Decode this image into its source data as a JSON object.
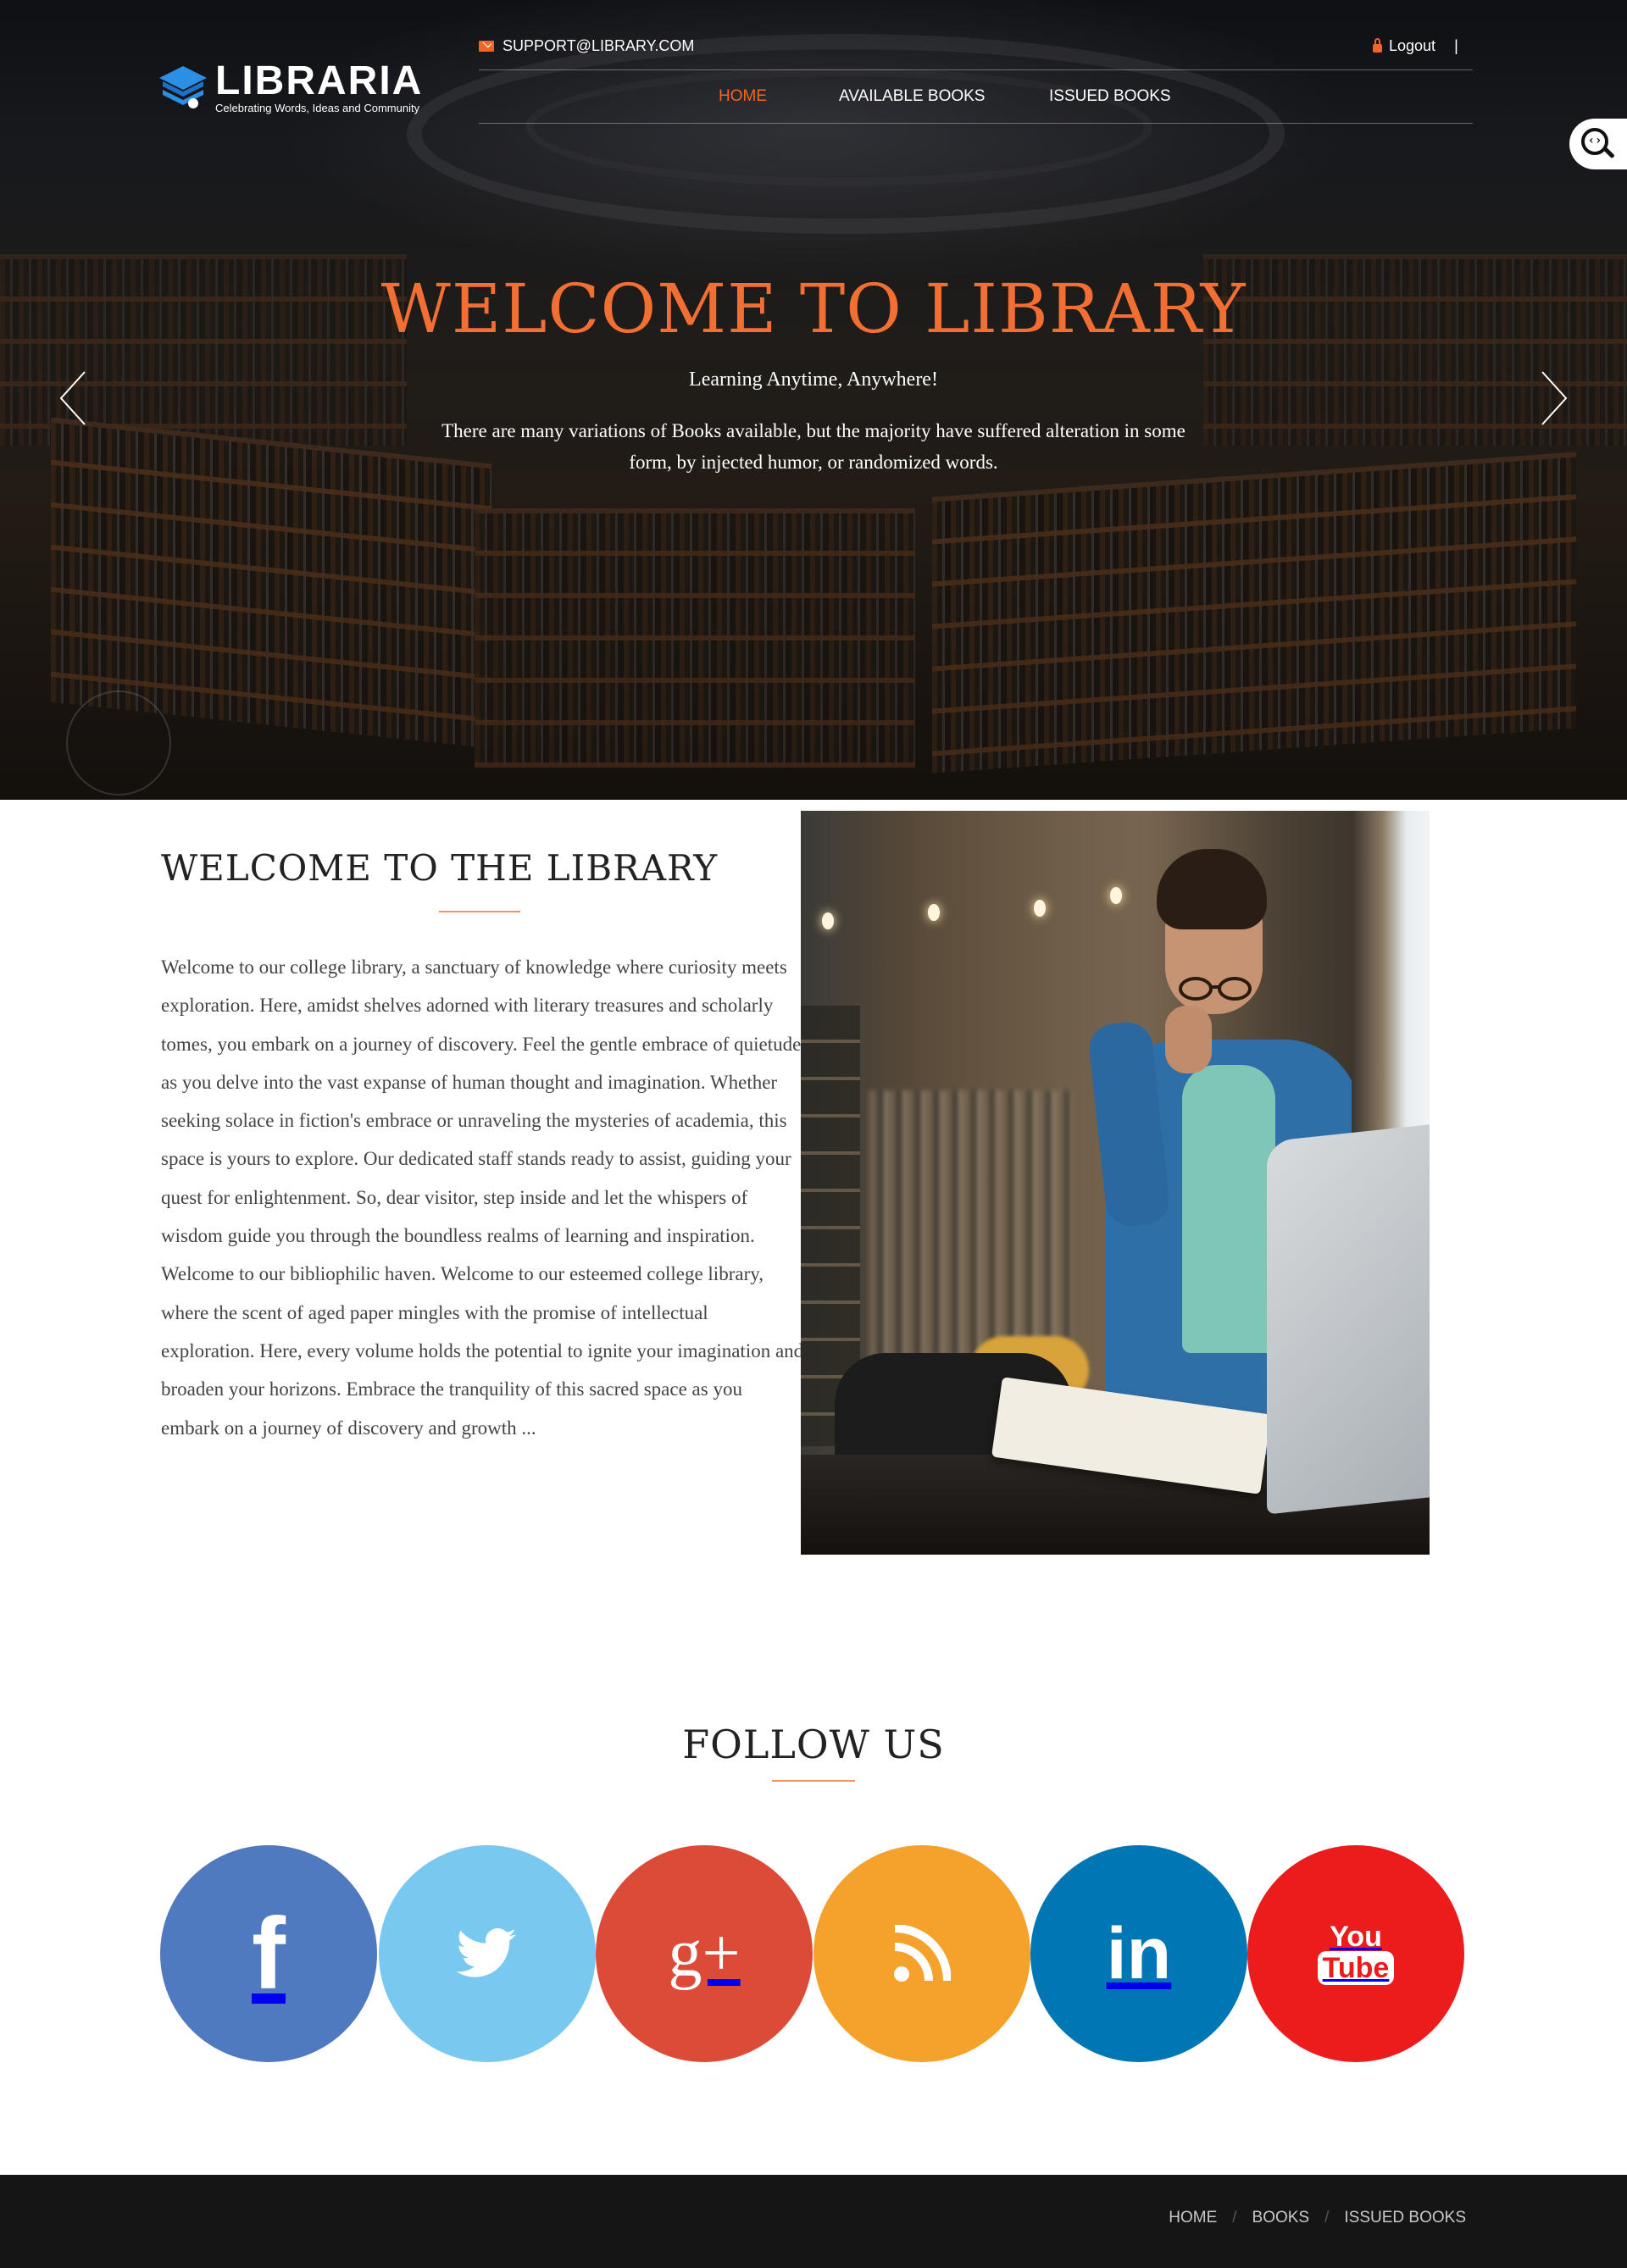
{
  "brand": {
    "name": "LIBRARIA",
    "tagline": "Celebrating Words, Ideas and Community"
  },
  "topbar": {
    "email": "SUPPORT@LIBRARY.COM",
    "logout_label": "Logout",
    "separator": "|"
  },
  "nav": {
    "items": [
      {
        "label": "HOME",
        "active": true
      },
      {
        "label": "AVAILABLE BOOKS",
        "active": false
      },
      {
        "label": "ISSUED BOOKS",
        "active": false
      }
    ]
  },
  "hero": {
    "title": "WELCOME TO LIBRARY",
    "subtitle": "Learning Anytime, Anywhere!",
    "description": "There are many variations of Books available, but the majority have suffered alteration in some form, by injected humor, or randomized words."
  },
  "about": {
    "title": "WELCOME TO THE LIBRARY",
    "text": "Welcome to our college library, a sanctuary of knowledge where curiosity meets exploration. Here, amidst shelves adorned with literary treasures and scholarly tomes, you embark on a journey of discovery. Feel the gentle embrace of quietude as you delve into the vast expanse of human thought and imagination. Whether seeking solace in fiction's embrace or unraveling the mysteries of academia, this space is yours to explore. Our dedicated staff stands ready to assist, guiding your quest for enlightenment. So, dear visitor, step inside and let the whispers of wisdom guide you through the boundless realms of learning and inspiration. Welcome to our bibliophilic haven. Welcome to our esteemed college library, where the scent of aged paper mingles with the promise of intellectual exploration. Here, every volume holds the potential to ignite your imagination and broaden your horizons. Embrace the tranquility of this sacred space as you embark on a journey of discovery and growth ..."
  },
  "follow": {
    "title": "FOLLOW US",
    "networks": [
      {
        "name": "facebook-icon",
        "glyph": "f",
        "color": "#507abf"
      },
      {
        "name": "twitter-icon",
        "glyph": "",
        "color": "#79c8ef"
      },
      {
        "name": "google-plus-icon",
        "glyph": "g+",
        "color": "#dc4b37"
      },
      {
        "name": "rss-icon",
        "glyph": "",
        "color": "#f5a22d"
      },
      {
        "name": "linkedin-icon",
        "glyph": "in",
        "color": "#0077b5"
      },
      {
        "name": "youtube-icon",
        "glyph_top": "You",
        "glyph_bottom": "Tube",
        "color": "#ec1c1c"
      }
    ]
  },
  "footer": {
    "links": [
      "HOME",
      "BOOKS",
      "ISSUED BOOKS"
    ],
    "separator": "/"
  },
  "colors": {
    "accent": "#f26522",
    "footer_bg": "#151515"
  }
}
